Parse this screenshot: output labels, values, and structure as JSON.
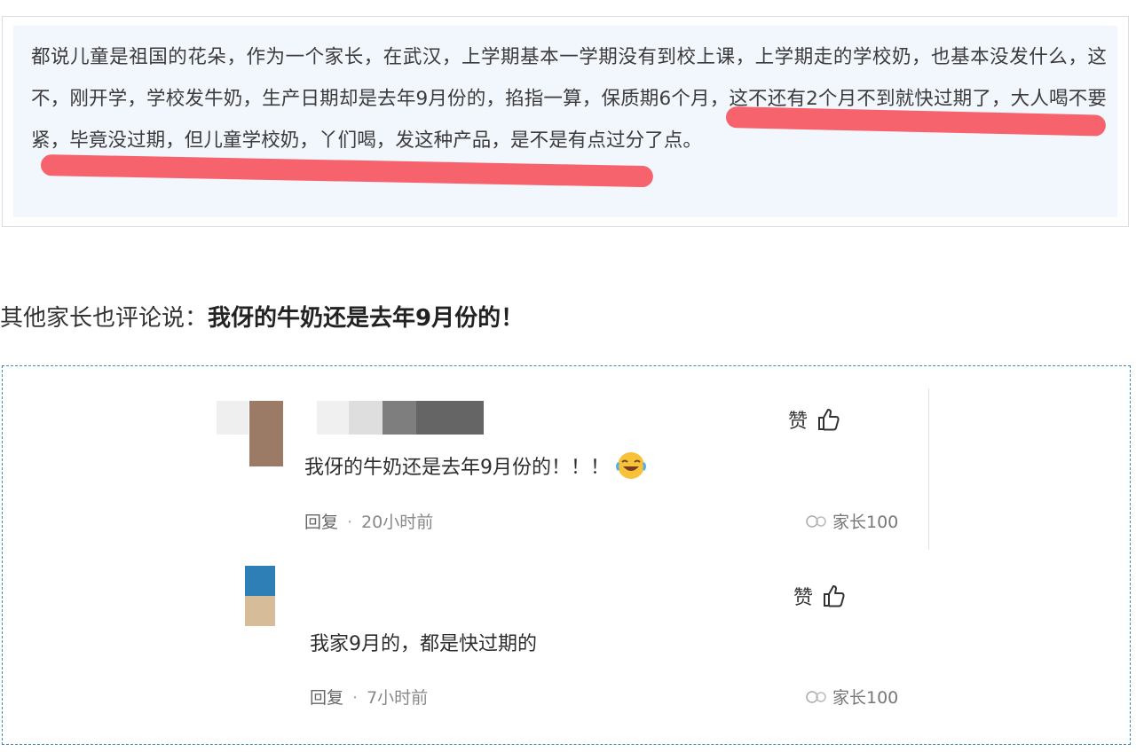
{
  "post": {
    "text": "都说儿童是祖国的花朵，作为一个家长，在武汉，上学期基本一学期没有到校上课，上学期走的学校奶，也基本没发什么，这不，刚开学，学校发牛奶，生产日期却是去年9月份的，掐指一算，保质期6个月，这不还有2个月不到就快过期了，大人喝不要紧，毕竟没过期，但儿童学校奶，丫们喝，发这种产品，是不是有点过分了点。"
  },
  "caption": {
    "prefix": "其他家长也评论说：",
    "quote": "我伢的牛奶还是去年9月份的！"
  },
  "colors": {
    "highlight": "#f7424c",
    "frame_border": "#3c8fb3",
    "post_bg": "#f2f6fd"
  },
  "comments": [
    {
      "like_label": "赞",
      "text": "我伢的牛奶还是去年9月份的！！！",
      "emoji": "laughing-crying-emoji",
      "reply_label": "回复",
      "time": "20小时前",
      "watermark": "家长100"
    },
    {
      "like_label": "赞",
      "text": "我家9月的，都是快过期的",
      "reply_label": "回复",
      "time": "7小时前",
      "watermark": "家长100"
    }
  ]
}
